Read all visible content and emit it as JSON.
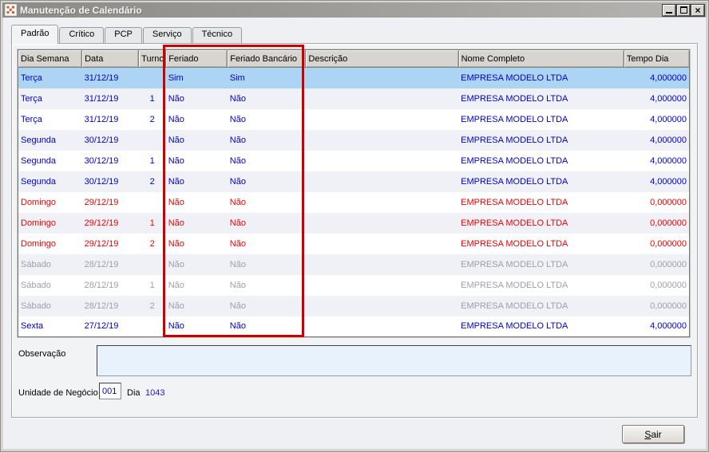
{
  "window": {
    "title": "Manutenção de Calendário"
  },
  "icons": {
    "close_glyph": "×"
  },
  "tabs": [
    {
      "label": "Padrão",
      "slug": "padrao",
      "active": true
    },
    {
      "label": "Crítico",
      "slug": "critico",
      "active": false
    },
    {
      "label": "PCP",
      "slug": "pcp",
      "active": false
    },
    {
      "label": "Serviço",
      "slug": "servico",
      "active": false
    },
    {
      "label": "Técnico",
      "slug": "tecnico",
      "active": false
    }
  ],
  "grid": {
    "columns": [
      "Dia Semana",
      "Data",
      "Turno",
      "Feriado",
      "Feriado Bancário",
      "Descrição",
      "Nome Completo",
      "Tempo Dia"
    ],
    "rows": [
      {
        "dia_semana": "Terça",
        "data": "31/12/19",
        "turno": "",
        "feriado": "Sim",
        "feriado_bancario": "Sim",
        "descricao": "",
        "nome_completo": "EMPRESA MODELO LTDA",
        "tempo_dia": "4,000000",
        "state": "blue",
        "selected": true
      },
      {
        "dia_semana": "Terça",
        "data": "31/12/19",
        "turno": "1",
        "feriado": "Não",
        "feriado_bancario": "Não",
        "descricao": "",
        "nome_completo": "EMPRESA MODELO LTDA",
        "tempo_dia": "4,000000",
        "state": "blue",
        "selected": false
      },
      {
        "dia_semana": "Terça",
        "data": "31/12/19",
        "turno": "2",
        "feriado": "Não",
        "feriado_bancario": "Não",
        "descricao": "",
        "nome_completo": "EMPRESA MODELO LTDA",
        "tempo_dia": "4,000000",
        "state": "blue",
        "selected": false
      },
      {
        "dia_semana": "Segunda",
        "data": "30/12/19",
        "turno": "",
        "feriado": "Não",
        "feriado_bancario": "Não",
        "descricao": "",
        "nome_completo": "EMPRESA MODELO LTDA",
        "tempo_dia": "4,000000",
        "state": "blue",
        "selected": false
      },
      {
        "dia_semana": "Segunda",
        "data": "30/12/19",
        "turno": "1",
        "feriado": "Não",
        "feriado_bancario": "Não",
        "descricao": "",
        "nome_completo": "EMPRESA MODELO LTDA",
        "tempo_dia": "4,000000",
        "state": "blue",
        "selected": false
      },
      {
        "dia_semana": "Segunda",
        "data": "30/12/19",
        "turno": "2",
        "feriado": "Não",
        "feriado_bancario": "Não",
        "descricao": "",
        "nome_completo": "EMPRESA MODELO LTDA",
        "tempo_dia": "4,000000",
        "state": "blue",
        "selected": false
      },
      {
        "dia_semana": "Domingo",
        "data": "29/12/19",
        "turno": "",
        "feriado": "Não",
        "feriado_bancario": "Não",
        "descricao": "",
        "nome_completo": "EMPRESA MODELO LTDA",
        "tempo_dia": "0,000000",
        "state": "red",
        "selected": false
      },
      {
        "dia_semana": "Domingo",
        "data": "29/12/19",
        "turno": "1",
        "feriado": "Não",
        "feriado_bancario": "Não",
        "descricao": "",
        "nome_completo": "EMPRESA MODELO LTDA",
        "tempo_dia": "0,000000",
        "state": "red",
        "selected": false
      },
      {
        "dia_semana": "Domingo",
        "data": "29/12/19",
        "turno": "2",
        "feriado": "Não",
        "feriado_bancario": "Não",
        "descricao": "",
        "nome_completo": "EMPRESA MODELO LTDA",
        "tempo_dia": "0,000000",
        "state": "red",
        "selected": false
      },
      {
        "dia_semana": "Sábado",
        "data": "28/12/19",
        "turno": "",
        "feriado": "Não",
        "feriado_bancario": "Não",
        "descricao": "",
        "nome_completo": "EMPRESA MODELO LTDA",
        "tempo_dia": "0,000000",
        "state": "gray",
        "selected": false
      },
      {
        "dia_semana": "Sábado",
        "data": "28/12/19",
        "turno": "1",
        "feriado": "Não",
        "feriado_bancario": "Não",
        "descricao": "",
        "nome_completo": "EMPRESA MODELO LTDA",
        "tempo_dia": "0,000000",
        "state": "gray",
        "selected": false
      },
      {
        "dia_semana": "Sábado",
        "data": "28/12/19",
        "turno": "2",
        "feriado": "Não",
        "feriado_bancario": "Não",
        "descricao": "",
        "nome_completo": "EMPRESA MODELO LTDA",
        "tempo_dia": "0,000000",
        "state": "gray",
        "selected": false
      },
      {
        "dia_semana": "Sexta",
        "data": "27/12/19",
        "turno": "",
        "feriado": "Não",
        "feriado_bancario": "Não",
        "descricao": "",
        "nome_completo": "EMPRESA MODELO LTDA",
        "tempo_dia": "4,000000",
        "state": "blue",
        "selected": false
      }
    ]
  },
  "fields": {
    "observacao_label": "Observação",
    "observacao_value": "",
    "unidade_label": "Unidade de Negócio",
    "unidade_value": "001",
    "dia_label": "Dia",
    "dia_value": "1043"
  },
  "footer": {
    "sair_label": "Sair",
    "sair_accesskey": "S",
    "sair_rest": "air"
  },
  "colors": {
    "highlight_border": "#cc0000",
    "selected_row_bg": "#abd5f2",
    "weekday_text": "#0000cd",
    "sunday_text": "#ee0000",
    "saturday_text": "#9da0a6"
  }
}
